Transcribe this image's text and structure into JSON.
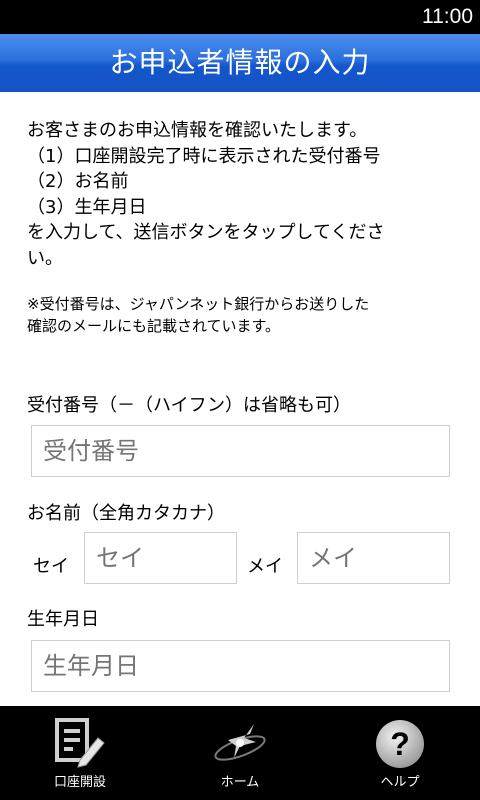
{
  "status_bar": {
    "time": "11:00"
  },
  "header": {
    "title": "お申込者情報の入力"
  },
  "intro": {
    "lines": [
      "お客さまのお申込情報を確認いたします。",
      "（1）口座開設完了時に表示された受付番号",
      "（2）お名前",
      "（3）生年月日",
      "を入力して、送信ボタンをタップしてくださ",
      "い。"
    ],
    "note_lines": [
      "※受付番号は、ジャパンネット銀行からお送りした",
      "確認のメールにも記載されています。"
    ]
  },
  "form": {
    "receipt_label": "受付番号（－（ハイフン）は省略も可）",
    "receipt_placeholder": "受付番号",
    "name_label": "お名前（全角カタカナ）",
    "sei_label": "セイ",
    "sei_placeholder": "セイ",
    "mei_label": "メイ",
    "mei_placeholder": "メイ",
    "birth_label": "生年月日",
    "birth_placeholder": "生年月日"
  },
  "nav": {
    "items": [
      {
        "label": "口座開設",
        "icon": "document-edit-icon"
      },
      {
        "label": "ホーム",
        "icon": "home-icon"
      },
      {
        "label": "ヘルプ",
        "icon": "help-icon"
      }
    ]
  }
}
